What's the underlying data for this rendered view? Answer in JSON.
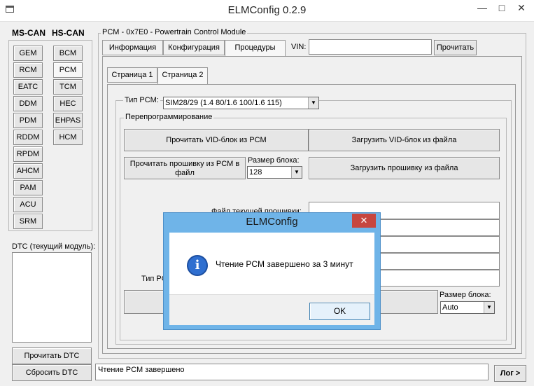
{
  "window": {
    "title": "ELMConfig 0.2.9",
    "controls": [
      "—",
      "□",
      "✕"
    ]
  },
  "left": {
    "ms_can_label": "MS-CAN",
    "hs_can_label": "HS-CAN",
    "ms_can_modules": [
      "GEM",
      "RCM",
      "EATC",
      "DDM",
      "PDM",
      "RDDM",
      "RPDM",
      "AHCM",
      "PAM",
      "ACU",
      "SRM"
    ],
    "hs_can_modules": [
      "BCM",
      "PCM",
      "TCM",
      "HEC",
      "EHPAS",
      "HCM"
    ],
    "dtc_label": "DTC (текущий модуль):",
    "read_dtc": "Прочитать DTC",
    "reset_dtc": "Сбросить DTC"
  },
  "module": {
    "group_title": "PCM - 0x7E0 - Powertrain Control Module",
    "tabs": [
      "Информация",
      "Конфигурация",
      "Процедуры"
    ],
    "vin_label": "VIN:",
    "vin_value": "",
    "read_button": "Прочитать",
    "pages": [
      "Страница 1",
      "Страница 2"
    ]
  },
  "procedures": {
    "pcm_type_label": "Тип PCM:",
    "pcm_type_value": "SIM28/29 (1.4 80/1.6 100/1.6 115)",
    "reprog_title": "Перепрограммирование",
    "read_vid": "Прочитать VID-блок из PCM",
    "load_vid": "Загрузить VID-блок из файла",
    "read_fw": "Прочитать прошивку из PCM в файл",
    "block_size_label": "Размер блока:",
    "block_size_value": "128",
    "load_fw": "Загрузить прошивку из файла",
    "current_fw_label": "Файл текущей прошивки:",
    "type_label_partial": "Тип PC",
    "block_size_label2": "Размер блока:",
    "block_size_value2": "Auto"
  },
  "status": {
    "text": "Чтение PCM завершено",
    "log_button": "Лог >"
  },
  "dialog": {
    "title": "ELMConfig",
    "close": "✕",
    "message": "Чтение PCM завершено за 3 минут",
    "ok": "OK",
    "info_glyph": "i"
  }
}
